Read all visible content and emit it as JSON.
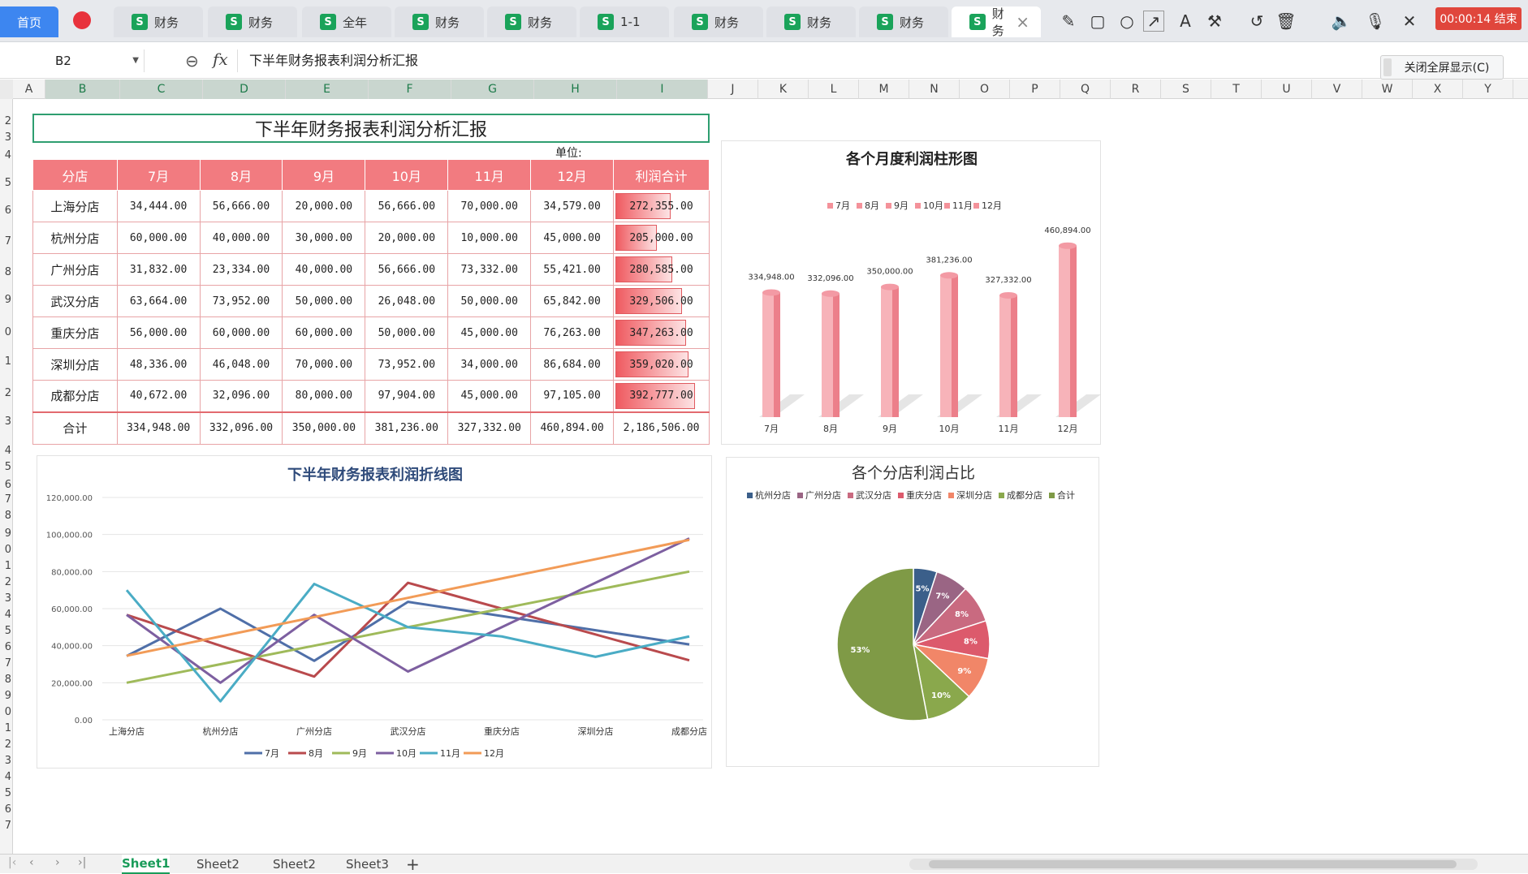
{
  "tabs": {
    "home": "首页",
    "items": [
      {
        "label": "财务",
        "x": 140
      },
      {
        "label": "财务",
        "x": 256
      },
      {
        "label": "全年",
        "x": 372
      },
      {
        "label": "财务",
        "x": 486
      },
      {
        "label": "财务",
        "x": 600
      },
      {
        "label": "1-1",
        "x": 714
      },
      {
        "label": "财务",
        "x": 830
      },
      {
        "label": "财务",
        "x": 944
      },
      {
        "label": "财务",
        "x": 1058
      },
      {
        "label": "财务",
        "x": 1172,
        "active": true
      }
    ]
  },
  "toolbar": {
    "timer": "00:00:14 结束",
    "fullscreen_label": "关闭全屏显示(C)"
  },
  "formula_bar": {
    "cell_ref": "B2",
    "content": "下半年财务报表利润分析汇报"
  },
  "sheet": {
    "title": "下半年财务报表利润分析汇报",
    "unit_label": "单位:",
    "headers": [
      "分店",
      "7月",
      "8月",
      "9月",
      "10月",
      "11月",
      "12月",
      "利润合计"
    ],
    "rows": [
      [
        "上海分店",
        "34,444.00",
        "56,666.00",
        "20,000.00",
        "56,666.00",
        "70,000.00",
        "34,579.00",
        "272,355.00"
      ],
      [
        "杭州分店",
        "60,000.00",
        "40,000.00",
        "30,000.00",
        "20,000.00",
        "10,000.00",
        "45,000.00",
        "205,000.00"
      ],
      [
        "广州分店",
        "31,832.00",
        "23,334.00",
        "40,000.00",
        "56,666.00",
        "73,332.00",
        "55,421.00",
        "280,585.00"
      ],
      [
        "武汉分店",
        "63,664.00",
        "73,952.00",
        "50,000.00",
        "26,048.00",
        "50,000.00",
        "65,842.00",
        "329,506.00"
      ],
      [
        "重庆分店",
        "56,000.00",
        "60,000.00",
        "60,000.00",
        "50,000.00",
        "45,000.00",
        "76,263.00",
        "347,263.00"
      ],
      [
        "深圳分店",
        "48,336.00",
        "46,048.00",
        "70,000.00",
        "73,952.00",
        "34,000.00",
        "86,684.00",
        "359,020.00"
      ],
      [
        "成都分店",
        "40,672.00",
        "32,096.00",
        "80,000.00",
        "97,904.00",
        "45,000.00",
        "97,105.00",
        "392,777.00"
      ]
    ],
    "total_row": [
      "合计",
      "334,948.00",
      "332,096.00",
      "350,000.00",
      "381,236.00",
      "327,332.00",
      "460,894.00",
      "2,186,506.00"
    ],
    "data_bar_values": [
      272355,
      205000,
      280585,
      329506,
      347263,
      359020,
      392777
    ]
  },
  "columns": [
    "A",
    "B",
    "C",
    "D",
    "E",
    "F",
    "G",
    "H",
    "I",
    "J",
    "K",
    "L",
    "M",
    "N",
    "O",
    "P",
    "Q",
    "R",
    "S",
    "T",
    "U",
    "V",
    "W",
    "X",
    "Y"
  ],
  "row_numbers": [
    "2",
    "3",
    "4",
    "5",
    "6",
    "7",
    "8",
    "9",
    "0",
    "1",
    "2",
    "3",
    "4",
    "5",
    "6",
    "7",
    "8",
    "9",
    "0",
    "1",
    "2",
    "3",
    "4",
    "5",
    "6",
    "7",
    "8",
    "9",
    "0",
    "1",
    "2",
    "3",
    "4",
    "5",
    "6",
    "7"
  ],
  "sheets": [
    "Sheet1",
    "Sheet2",
    "Sheet2",
    "Sheet3"
  ],
  "chart_data": [
    {
      "type": "bar",
      "title": "各个月度利润柱形图",
      "categories": [
        "7月",
        "8月",
        "9月",
        "10月",
        "11月",
        "12月"
      ],
      "values": [
        334948,
        332096,
        350000,
        381236,
        327332,
        460894
      ],
      "labels": [
        "334,948.00",
        "332,096.00",
        "350,000.00",
        "381,236.00",
        "327,332.00",
        "460,894.00"
      ],
      "legend": [
        "7月",
        "8月",
        "9月",
        "10月",
        "11月",
        "12月"
      ],
      "legend_position": "top",
      "color": "#f4929a",
      "ylim": [
        0,
        480000
      ]
    },
    {
      "type": "line",
      "title": "下半年财务报表利润折线图",
      "categories": [
        "上海分店",
        "杭州分店",
        "广州分店",
        "武汉分店",
        "重庆分店",
        "深圳分店",
        "成都分店"
      ],
      "yticks": [
        "0.00",
        "20,000.00",
        "40,000.00",
        "60,000.00",
        "80,000.00",
        "100,000.00",
        "120,000.00"
      ],
      "ylim": [
        0,
        120000
      ],
      "legend_position": "bottom",
      "series": [
        {
          "name": "7月",
          "color": "#4f6fa8",
          "values": [
            34444,
            60000,
            31832,
            63664,
            56000,
            48336,
            40672
          ]
        },
        {
          "name": "8月",
          "color": "#b94a4d",
          "values": [
            56666,
            40000,
            23334,
            73952,
            60000,
            46048,
            32096
          ]
        },
        {
          "name": "9月",
          "color": "#9fba5a",
          "values": [
            20000,
            30000,
            40000,
            50000,
            60000,
            70000,
            80000
          ]
        },
        {
          "name": "10月",
          "color": "#7d5fa0",
          "values": [
            56666,
            20000,
            56666,
            26048,
            50000,
            73952,
            97904
          ]
        },
        {
          "name": "11月",
          "color": "#4aacc5",
          "values": [
            70000,
            10000,
            73332,
            50000,
            45000,
            34000,
            45000
          ]
        },
        {
          "name": "12月",
          "color": "#f29b57",
          "values": [
            34579,
            45000,
            55421,
            65842,
            76263,
            86684,
            97105
          ]
        }
      ]
    },
    {
      "type": "pie",
      "title": "各个分店利润占比",
      "legend_position": "top",
      "legend": [
        {
          "name": "杭州分店",
          "color": "#3b5f8a"
        },
        {
          "name": "广州分店",
          "color": "#9a6584"
        },
        {
          "name": "武汉分店",
          "color": "#c96a80"
        },
        {
          "name": "重庆分店",
          "color": "#dc5a6c"
        },
        {
          "name": "深圳分店",
          "color": "#f18668"
        },
        {
          "name": "成都分店",
          "color": "#8aa84c"
        },
        {
          "name": "合计",
          "color": "#7f9a46"
        }
      ],
      "slices": [
        {
          "name": "杭州分店",
          "value": 5,
          "label": "5%",
          "color": "#3b5f8a"
        },
        {
          "name": "广州分店",
          "value": 7,
          "label": "7%",
          "color": "#9a6584"
        },
        {
          "name": "武汉分店",
          "value": 8,
          "label": "8%",
          "color": "#c96a80"
        },
        {
          "name": "重庆分店",
          "value": 8,
          "label": "8%",
          "color": "#dc5a6c"
        },
        {
          "name": "深圳分店",
          "value": 9,
          "label": "9%",
          "color": "#f18668"
        },
        {
          "name": "成都分店",
          "value": 10,
          "label": "10%",
          "color": "#8aa84c"
        },
        {
          "name": "合计",
          "value": 53,
          "label": "53%",
          "color": "#7f9a46"
        }
      ]
    }
  ]
}
